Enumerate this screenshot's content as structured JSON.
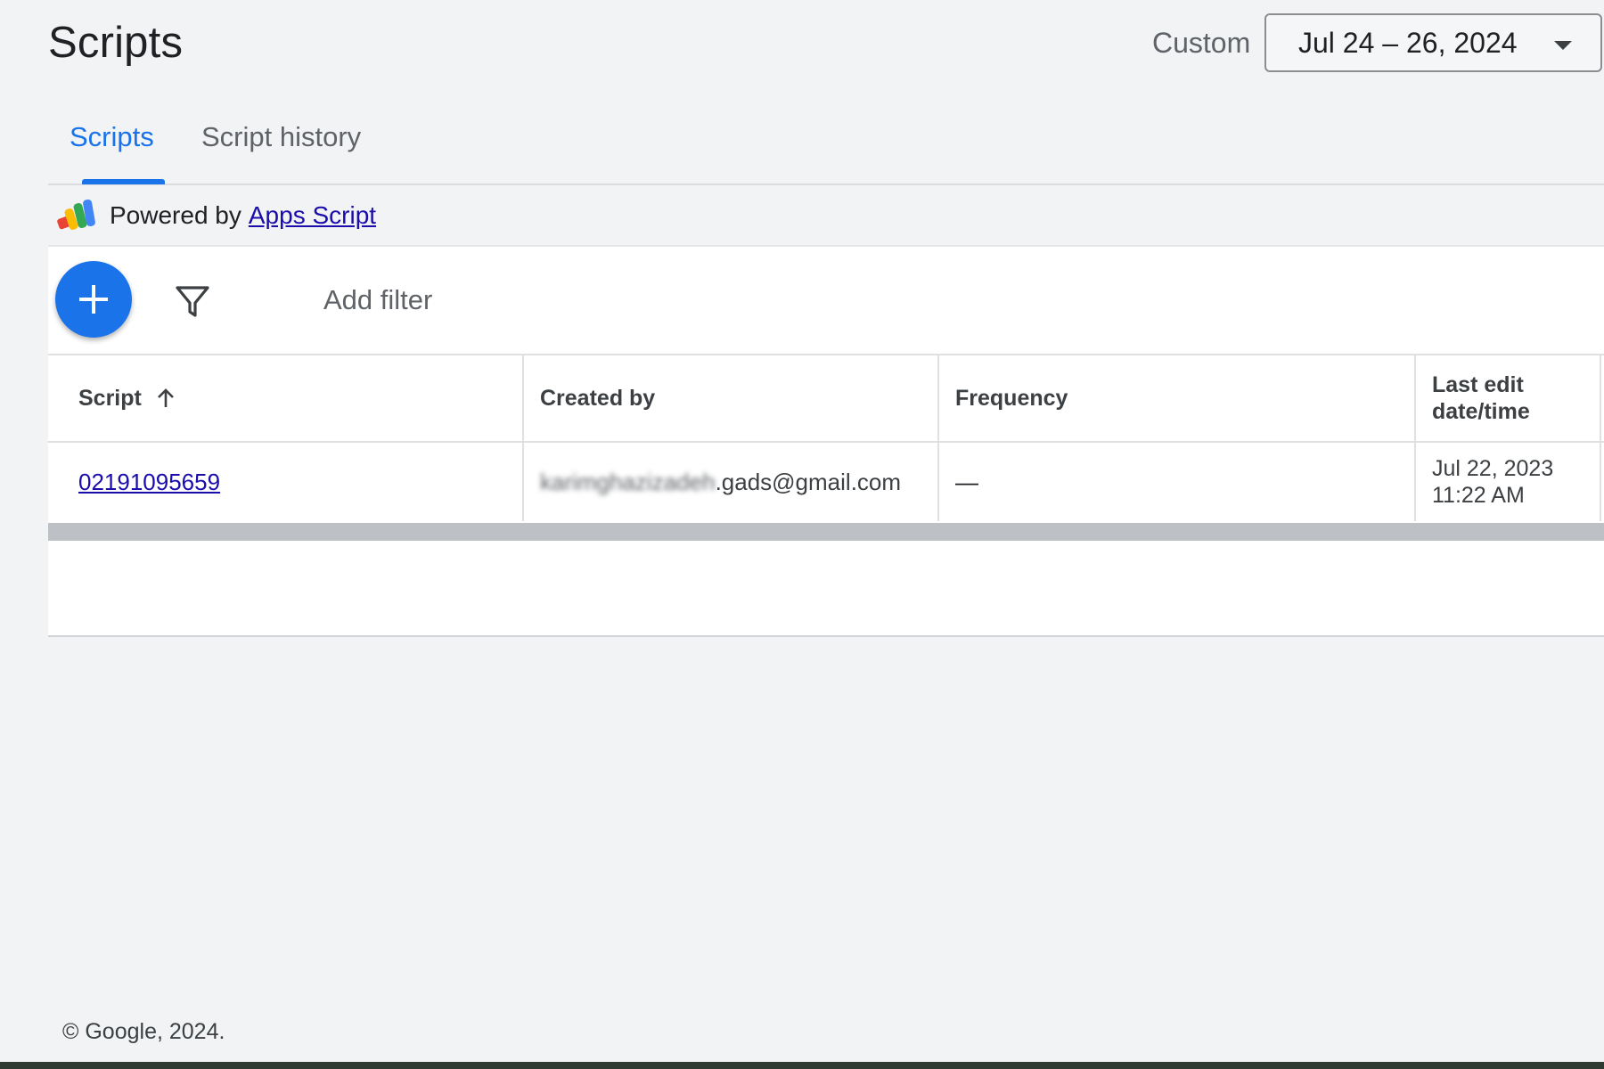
{
  "header": {
    "title": "Scripts",
    "date_label": "Custom",
    "date_range": "Jul 24 – 26, 2024"
  },
  "tabs": [
    {
      "label": "Scripts",
      "active": true
    },
    {
      "label": "Script history",
      "active": false
    }
  ],
  "powered": {
    "prefix": "Powered by",
    "link": "Apps Script"
  },
  "toolbar": {
    "add_filter": "Add filter",
    "fab_icon": "plus-icon",
    "filter_icon": "filter-icon"
  },
  "table": {
    "columns": [
      "Script",
      "Created by",
      "Frequency",
      "Last edit date/time"
    ],
    "rows": [
      {
        "script": "02191095659",
        "created_by_blurred": "karimghazizadeh",
        "created_by_domain": ".gads@gmail.com",
        "frequency": "—",
        "last_edit_date": "Jul 22, 2023",
        "last_edit_time": "11:22 AM"
      }
    ]
  },
  "footer": {
    "copyright": "© Google, 2024."
  },
  "colors": {
    "accent": "#1a73e8",
    "link": "#1a0dab",
    "background": "#f1f3f4"
  }
}
